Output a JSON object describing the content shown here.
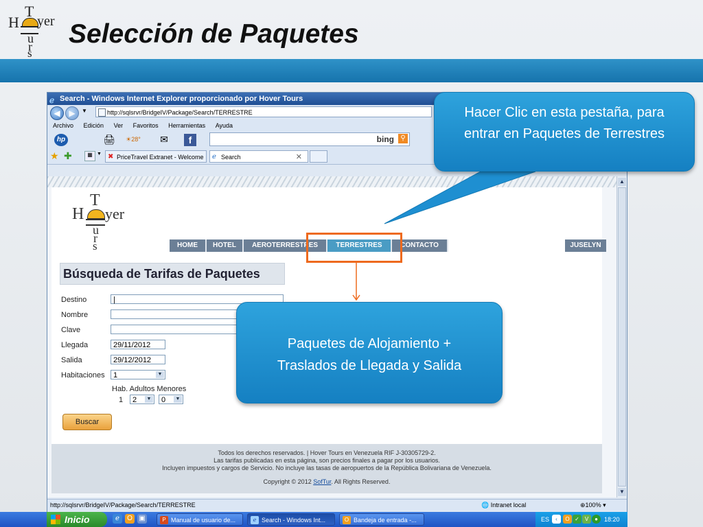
{
  "slide": {
    "title": "Selección de Paquetes",
    "logo": {
      "t": "T",
      "h": "H",
      "yer": "yer",
      "u": "u",
      "r": "r",
      "s": "s"
    }
  },
  "browser": {
    "window_title": "Search - Windows Internet Explorer proporcionado por Hover Tours",
    "address": "http://sqlsrvr/BridgeIV/Package/Search/TERRESTRE",
    "menu": [
      "Archivo",
      "Edición",
      "Ver",
      "Favoritos",
      "Herramientas",
      "Ayuda"
    ],
    "weather": "28°",
    "bing_label": "bing",
    "tabs": [
      {
        "label": "PriceTravel Extranet - Welcome"
      },
      {
        "label": "Search"
      }
    ],
    "status_url": "http://sqlsrvr/BridgeIV/Package/Search/TERRESTRE",
    "status_zone": "Intranet local",
    "zoom": "100%"
  },
  "site": {
    "logo": {
      "t": "T",
      "h": "H",
      "yer": "yer",
      "u": "u",
      "r": "r",
      "s": "s"
    },
    "nav": [
      "HOME",
      "HOTEL",
      "AEROTERRESTRES",
      "TERRESTRES",
      "CONTACTO"
    ],
    "active_nav": "TERRESTRES",
    "user": "JUSELYN",
    "form_title": "Búsqueda de Tarifas de Paquetes",
    "fields": {
      "destino_label": "Destino",
      "nombre_label": "Nombre",
      "clave_label": "Clave",
      "llegada_label": "Llegada",
      "llegada_value": "29/11/2012",
      "salida_label": "Salida",
      "salida_value": "29/12/2012",
      "habitaciones_label": "Habitaciones",
      "habitaciones_value": "1",
      "room_header": "Hab. Adultos Menores",
      "room_number": "1",
      "adultos_value": "2",
      "menores_value": "0"
    },
    "search_button": "Buscar",
    "footer": {
      "line1": "Todos los derechos reservados. | Hover Tours en Venezuela RIF J-30305729-2.",
      "line2": "Las tarifas publicadas en esta página, son precios finales a pagar por los usuarios.",
      "line3": "Incluyen impuestos y cargos de Servicio. No incluye las tasas de aeropuertos de la República Bolivariana de Venezuela.",
      "copyright_prefix": "Copyright © 2012 ",
      "copyright_link": "SofTur",
      "copyright_suffix": ". All Rights Reserved."
    }
  },
  "callouts": {
    "top_line1": "Hacer Clic en esta pestaña, para",
    "top_line2": "entrar en Paquetes de Terrestres",
    "middle_line1": "Paquetes de Alojamiento +",
    "middle_line2": "Traslados de Llegada y Salida"
  },
  "taskbar": {
    "start": "Inicio",
    "tasks": [
      "Manual de usuario de...",
      "Search - Windows Int...",
      "Bandeja de entrada -..."
    ],
    "lang": "ES",
    "clock": "18:20"
  },
  "colors": {
    "band": "#1f7fba",
    "callout": "#1e8fd1",
    "highlight": "#ee6a1e",
    "nav": "#6b7f96",
    "nav_active": "#4a9cc4"
  }
}
